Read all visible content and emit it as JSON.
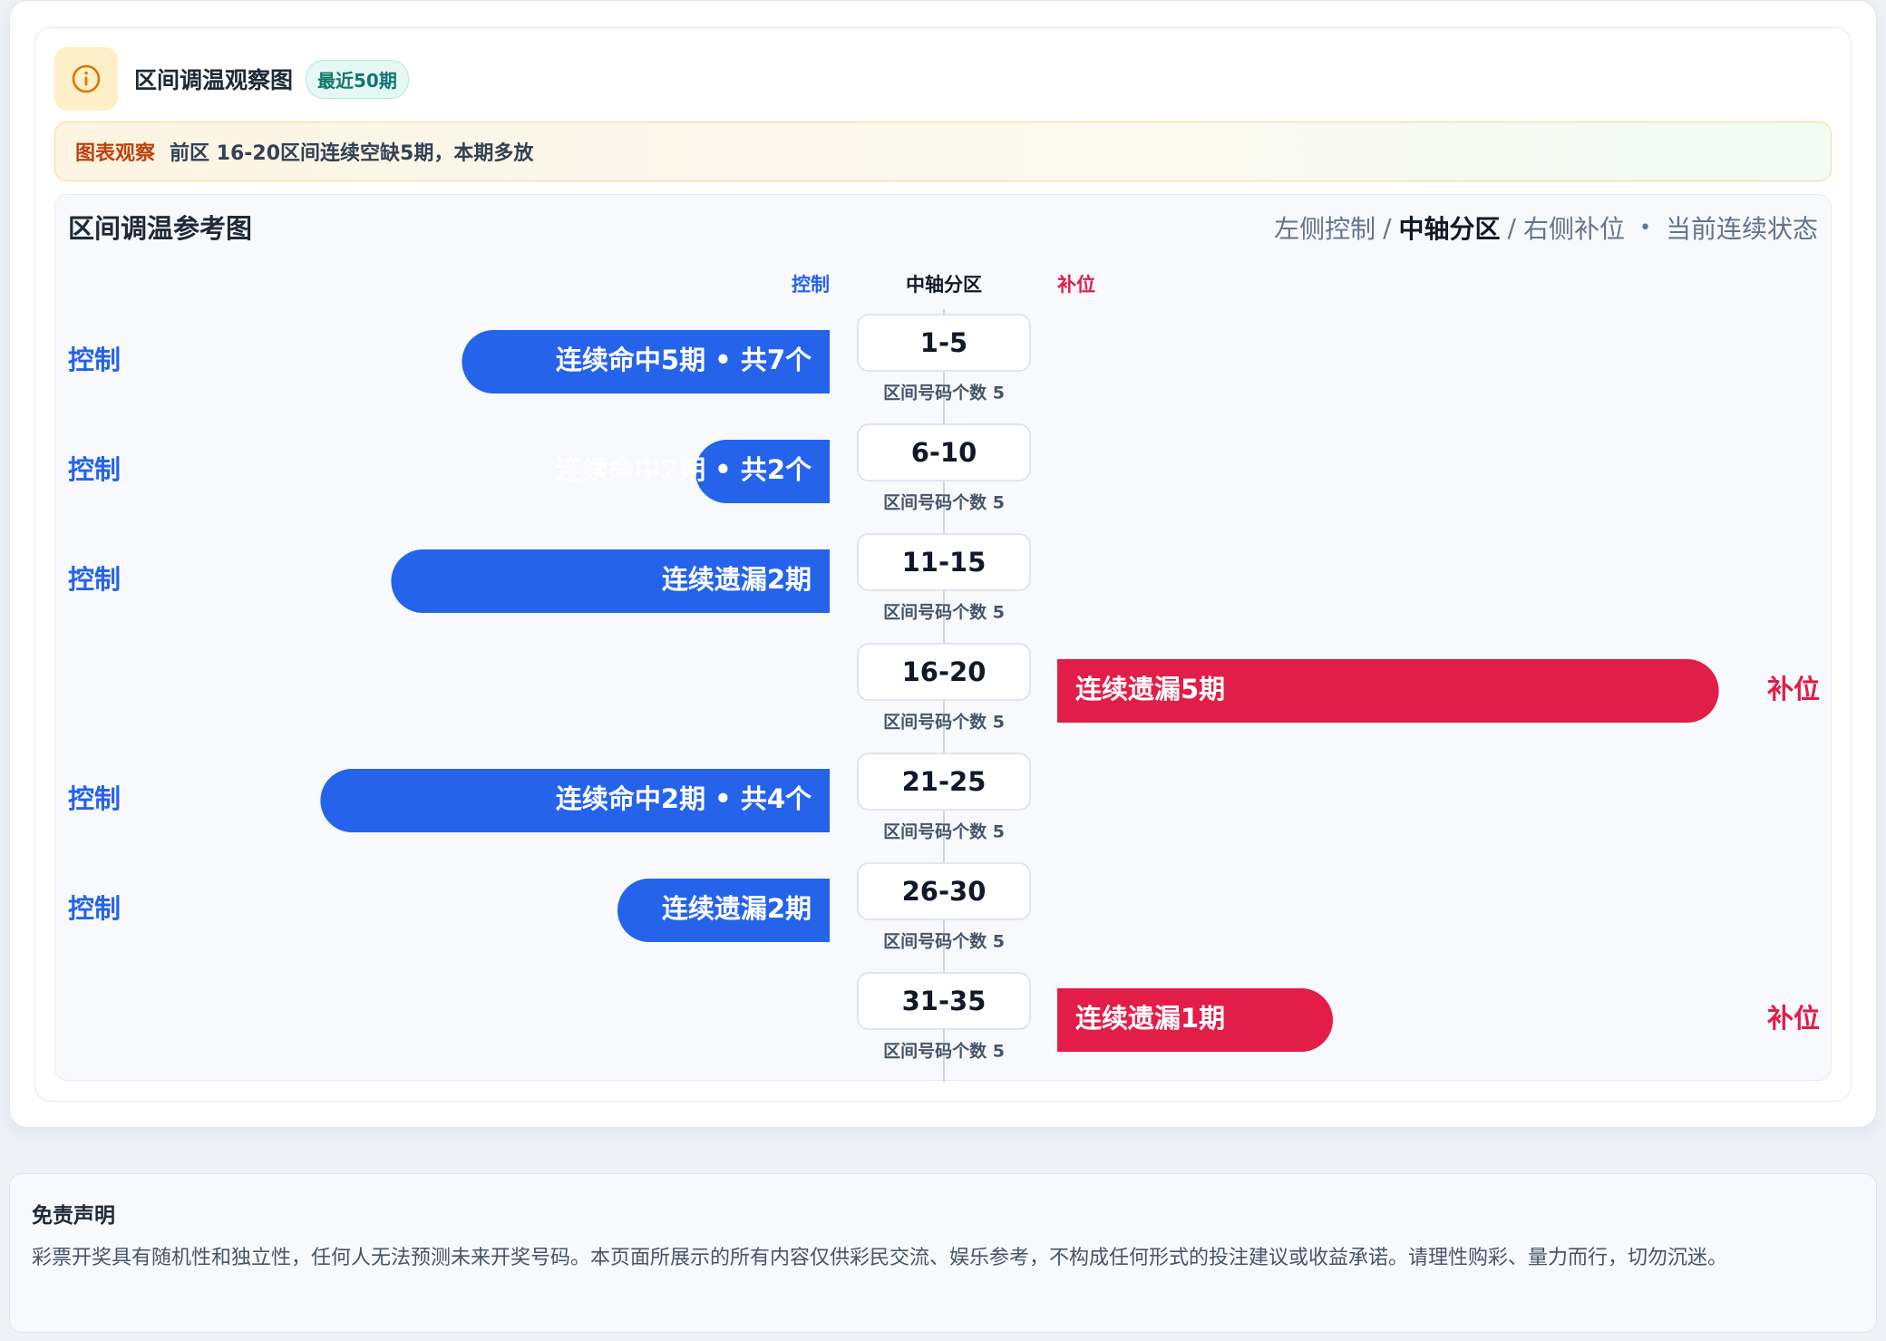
{
  "header": {
    "title": "区间调温观察图",
    "badge": "最近50期"
  },
  "note": {
    "tag": "图表观察",
    "text": "前区 16-20区间连续空缺5期，本期多放"
  },
  "panel": {
    "title": "区间调温参考图",
    "legend": {
      "left": "左侧控制",
      "sep1": "/",
      "center": "中轴分区",
      "sep2": "/",
      "right": "右侧补位",
      "dot": "•",
      "state": "当前连续状态"
    }
  },
  "colors": {
    "control": "#2563eb",
    "fill": "#e11d48",
    "axis": "#cbd5e1"
  },
  "chart_data": {
    "type": "bar",
    "column_headers": {
      "left": "控制",
      "center": "中轴分区",
      "right": "补位"
    },
    "sublabel_prefix": "区间号码个数",
    "rows": [
      {
        "range": "1-5",
        "count": 5,
        "side": "控制",
        "direction": "left",
        "level": 0.52,
        "label": "连续命中5期 • 共7个"
      },
      {
        "range": "6-10",
        "count": 5,
        "side": "控制",
        "direction": "left",
        "level": 0.19,
        "label": "连续命中2期 • 共2个"
      },
      {
        "range": "11-15",
        "count": 5,
        "side": "控制",
        "direction": "left",
        "level": 0.62,
        "label": "连续遗漏2期"
      },
      {
        "range": "16-20",
        "count": 5,
        "side": "补位",
        "direction": "right",
        "level": 0.96,
        "label": "连续遗漏5期"
      },
      {
        "range": "21-25",
        "count": 5,
        "side": "控制",
        "direction": "left",
        "level": 0.72,
        "label": "连续命中2期 • 共4个"
      },
      {
        "range": "26-30",
        "count": 5,
        "side": "控制",
        "direction": "left",
        "level": 0.3,
        "label": "连续遗漏2期"
      },
      {
        "range": "31-35",
        "count": 5,
        "side": "补位",
        "direction": "right",
        "level": 0.4,
        "label": "连续遗漏1期"
      }
    ]
  },
  "disclaimer": {
    "title": "免责声明",
    "text": "彩票开奖具有随机性和独立性，任何人无法预测未来开奖号码。本页面所展示的所有内容仅供彩民交流、娱乐参考，不构成任何形式的投注建议或收益承诺。请理性购彩、量力而行，切勿沉迷。"
  }
}
